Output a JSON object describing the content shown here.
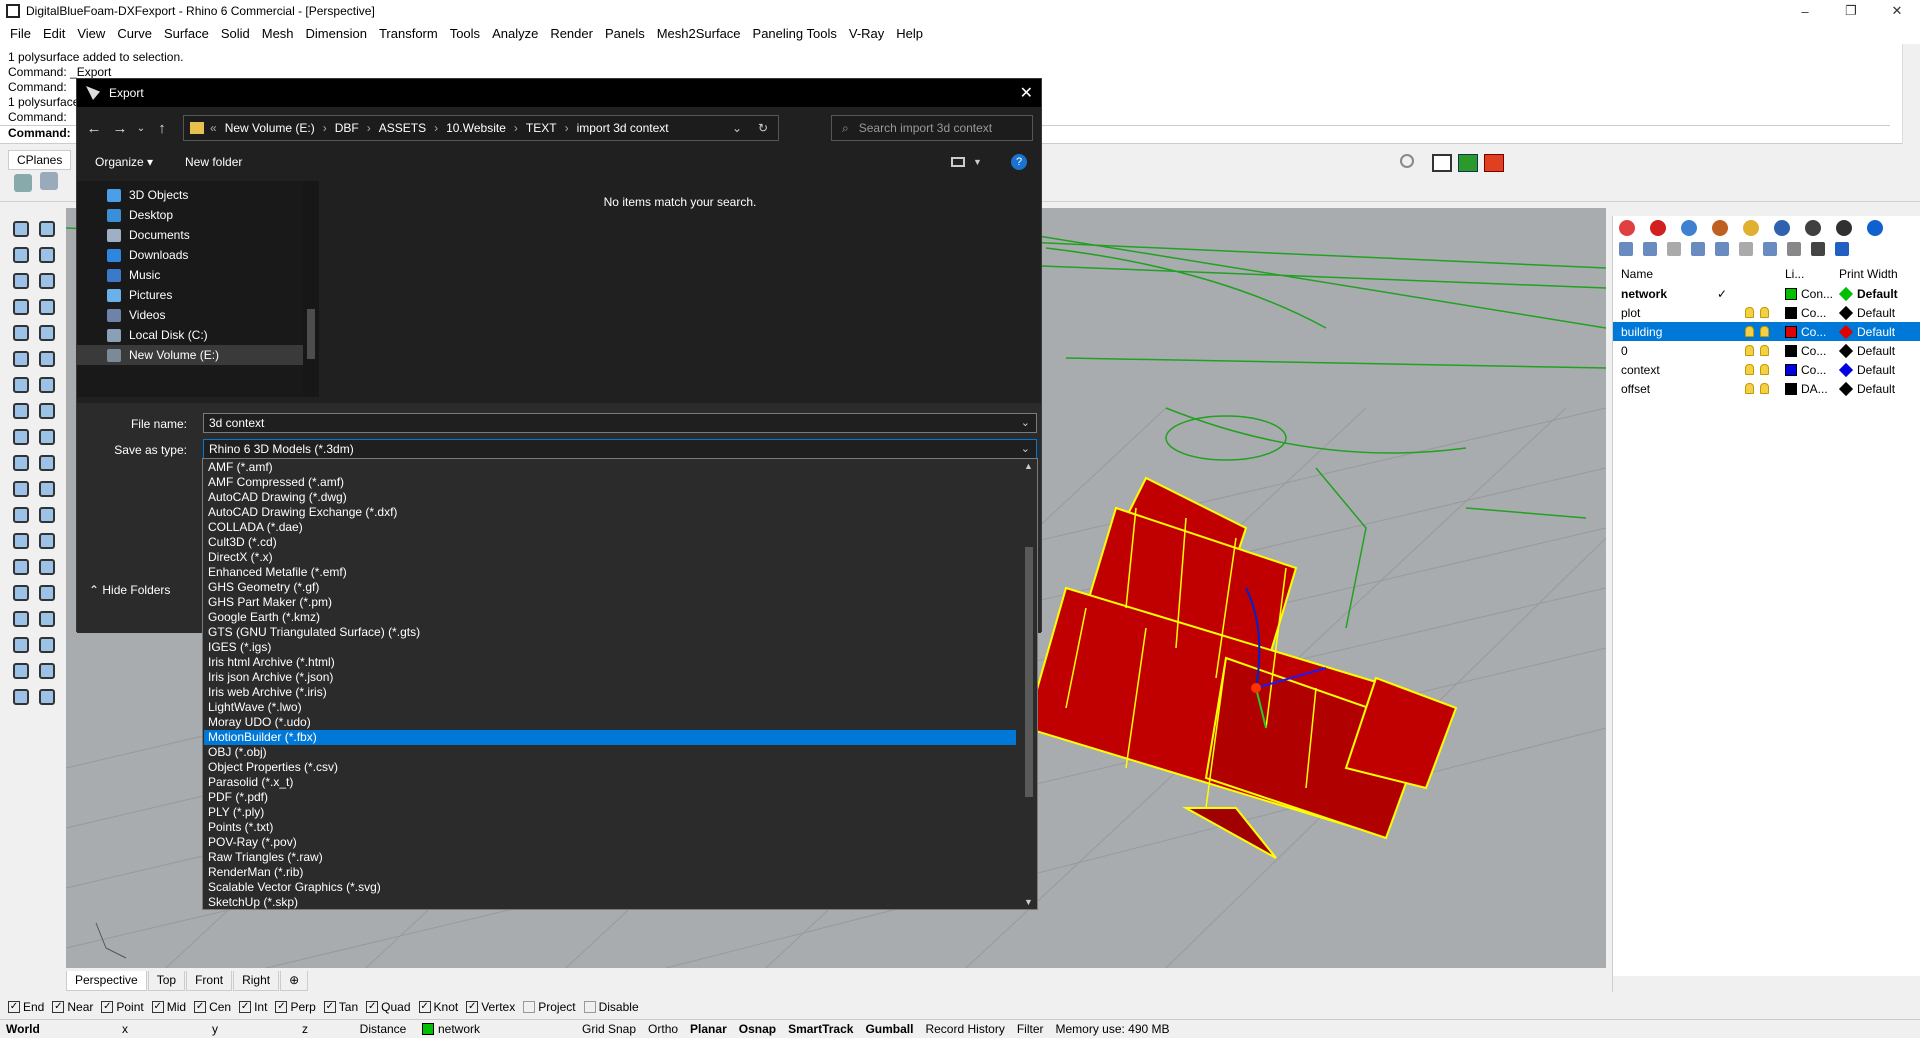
{
  "window": {
    "title": "DigitalBlueFoam-DXFexport - Rhino 6 Commercial - [Perspective]",
    "minimize": "–",
    "maximize": "❐",
    "close": "✕"
  },
  "menu": [
    "File",
    "Edit",
    "View",
    "Curve",
    "Surface",
    "Solid",
    "Mesh",
    "Dimension",
    "Transform",
    "Tools",
    "Analyze",
    "Render",
    "Panels",
    "Mesh2Surface",
    "Paneling Tools",
    "V-Ray",
    "Help"
  ],
  "command_history": [
    "1 polysurface added to selection.",
    "Command: _Export",
    "Command:",
    "1 polysurface",
    "Command:"
  ],
  "command_prompt": "Command:",
  "toolbar_tab": "CPlanes",
  "viewport_tabs": [
    "Perspective",
    "Top",
    "Front",
    "Right"
  ],
  "viewport_add": "⊕",
  "osnaps": [
    {
      "label": "End",
      "checked": true
    },
    {
      "label": "Near",
      "checked": true
    },
    {
      "label": "Point",
      "checked": true
    },
    {
      "label": "Mid",
      "checked": true
    },
    {
      "label": "Cen",
      "checked": true
    },
    {
      "label": "Int",
      "checked": true
    },
    {
      "label": "Perp",
      "checked": true
    },
    {
      "label": "Tan",
      "checked": true
    },
    {
      "label": "Quad",
      "checked": true
    },
    {
      "label": "Knot",
      "checked": true
    },
    {
      "label": "Vertex",
      "checked": true
    },
    {
      "label": "Project",
      "checked": false
    },
    {
      "label": "Disable",
      "checked": false
    }
  ],
  "status": {
    "world": "World",
    "x": "x",
    "y": "y",
    "z": "z",
    "distance": "Distance",
    "layer": "network",
    "layer_color": "#00c000",
    "grid_snap": "Grid Snap",
    "ortho": "Ortho",
    "planar": "Planar",
    "osnap": "Osnap",
    "smarttrack": "SmartTrack",
    "gumball": "Gumball",
    "record_history": "Record History",
    "filter": "Filter",
    "memory": "Memory use: 490 MB"
  },
  "layers": {
    "headers": {
      "name": "Name",
      "linetype": "Li...",
      "print_width": "Print Width"
    },
    "rows": [
      {
        "name": "network",
        "current": "✓",
        "color": "#00c000",
        "material": "Con...",
        "print_color": "#00c000",
        "print_width": "Default",
        "bold": true,
        "selected": false
      },
      {
        "name": "plot",
        "current": "",
        "color": "#000000",
        "material": "Co...",
        "print_color": "#000000",
        "print_width": "Default",
        "bold": false,
        "selected": false
      },
      {
        "name": "building",
        "current": "",
        "color": "#e00000",
        "material": "Co...",
        "print_color": "#e00000",
        "print_width": "Default",
        "bold": false,
        "selected": true
      },
      {
        "name": "0",
        "current": "",
        "color": "#000000",
        "material": "Co...",
        "print_color": "#000000",
        "print_width": "Default",
        "bold": false,
        "selected": false
      },
      {
        "name": "context",
        "current": "",
        "color": "#0000e0",
        "material": "Co...",
        "print_color": "#0000e0",
        "print_width": "Default",
        "bold": false,
        "selected": false
      },
      {
        "name": "offset",
        "current": "",
        "color": "#000000",
        "material": "DA...",
        "print_color": "#000000",
        "print_width": "Default",
        "bold": false,
        "selected": false
      }
    ]
  },
  "dialog": {
    "title": "Export",
    "close": "✕",
    "breadcrumb": [
      "New Volume (E:)",
      "DBF",
      "ASSETS",
      "10.Website",
      "TEXT",
      "import 3d context"
    ],
    "breadcrumb_prefix": "«",
    "search_placeholder": "Search import 3d context",
    "organize": "Organize ▾",
    "new_folder": "New folder",
    "empty_message": "No items match your search.",
    "nav_items": [
      {
        "label": "3D Objects",
        "color": "#4a9fe8"
      },
      {
        "label": "Desktop",
        "color": "#3b8fd6"
      },
      {
        "label": "Documents",
        "color": "#9fb0c4"
      },
      {
        "label": "Downloads",
        "color": "#2f86e0"
      },
      {
        "label": "Music",
        "color": "#3a7ac9"
      },
      {
        "label": "Pictures",
        "color": "#6bb0e8"
      },
      {
        "label": "Videos",
        "color": "#6f82a8"
      },
      {
        "label": "Local Disk (C:)",
        "color": "#8aa0b8"
      },
      {
        "label": "New Volume (E:)",
        "color": "#7a8a99"
      }
    ],
    "file_name_label": "File name:",
    "file_name": "3d context",
    "save_type_label": "Save as type:",
    "save_type": "Rhino 6 3D Models (*.3dm)",
    "hide_folders": "⌃ Hide Folders",
    "file_types": [
      "AMF (*.amf)",
      "AMF Compressed (*.amf)",
      "AutoCAD Drawing (*.dwg)",
      "AutoCAD Drawing Exchange (*.dxf)",
      "COLLADA (*.dae)",
      "Cult3D (*.cd)",
      "DirectX (*.x)",
      "Enhanced Metafile (*.emf)",
      "GHS Geometry (*.gf)",
      "GHS Part Maker (*.pm)",
      "Google Earth (*.kmz)",
      "GTS (GNU Triangulated Surface) (*.gts)",
      "IGES (*.igs)",
      "Iris html Archive (*.html)",
      "Iris json Archive (*.json)",
      "Iris web Archive (*.iris)",
      "LightWave (*.lwo)",
      "Moray UDO (*.udo)",
      "MotionBuilder (*.fbx)",
      "OBJ (*.obj)",
      "Object Properties (*.csv)",
      "Parasolid (*.x_t)",
      "PDF (*.pdf)",
      "PLY (*.ply)",
      "Points (*.txt)",
      "POV-Ray (*.pov)",
      "Raw Triangles (*.raw)",
      "RenderMan (*.rib)",
      "Scalable Vector Graphics (*.svg)",
      "SketchUp (*.skp)"
    ],
    "selected_type": "MotionBuilder (*.fbx)"
  },
  "colors": {
    "accent": "#0078d7",
    "building_fill": "#c00000",
    "building_edge": "#ffff00",
    "context_curves": "#22a022"
  }
}
